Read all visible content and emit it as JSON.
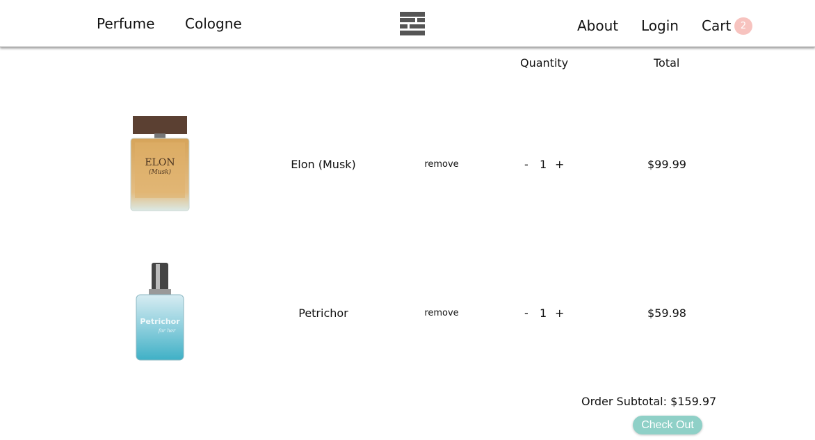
{
  "header": {
    "nav_left": [
      "Perfume",
      "Cologne"
    ],
    "nav_right": {
      "about": "About",
      "login": "Login",
      "cart": "Cart"
    },
    "cart_count": "2",
    "logo_icon": "logo-icon"
  },
  "cart": {
    "columns": {
      "quantity": "Quantity",
      "total": "Total"
    },
    "items": [
      {
        "name": "Elon (Musk)",
        "remove": "remove",
        "minus": "-",
        "quantity": "1",
        "plus": "+",
        "total": "$99.99",
        "bottle_label": "ELON",
        "bottle_script": "(Musk)",
        "icon": "perfume-bottle-amber"
      },
      {
        "name": "Petrichor",
        "remove": "remove",
        "minus": "-",
        "quantity": "1",
        "plus": "+",
        "total": "$59.98",
        "bottle_label": "Petrichor",
        "bottle_script": "for her",
        "icon": "perfume-bottle-blue"
      }
    ],
    "subtotal": "Order Subtotal: $159.97",
    "checkout_label": "Check Out"
  },
  "colors": {
    "cart_badge": "#f7c3bf",
    "checkout_button": "#8fd0c7",
    "logo": "#555555"
  }
}
